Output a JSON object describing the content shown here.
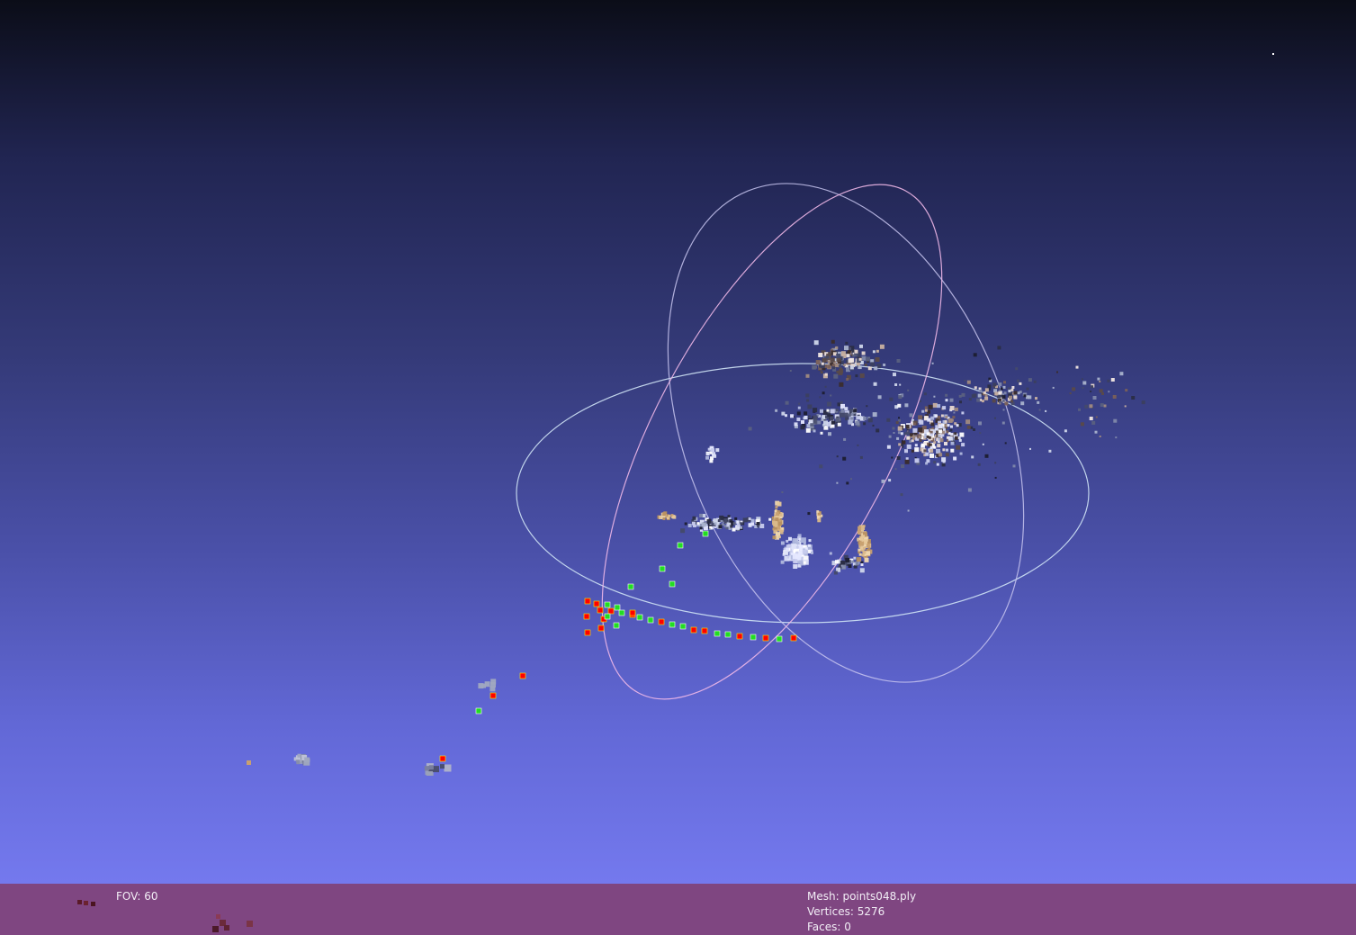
{
  "viewer": {
    "fov_text": "FOV: 60",
    "mesh_name_text": "Mesh: points048.ply",
    "vertices_text": "Vertices: 5276",
    "faces_text": "Faces: 0"
  },
  "colors": {
    "background_top": "#0b0d18",
    "background_bottom": "#7479ee",
    "statusbar": "#7f4681",
    "trackball_ring": "#c8d0f0",
    "trackball_ring_vertical": "#f0b8e8",
    "camera_red": "#ff0000",
    "camera_green": "#22dd22",
    "point_tan": "#d9b88a",
    "point_white": "#f0f0ff"
  }
}
